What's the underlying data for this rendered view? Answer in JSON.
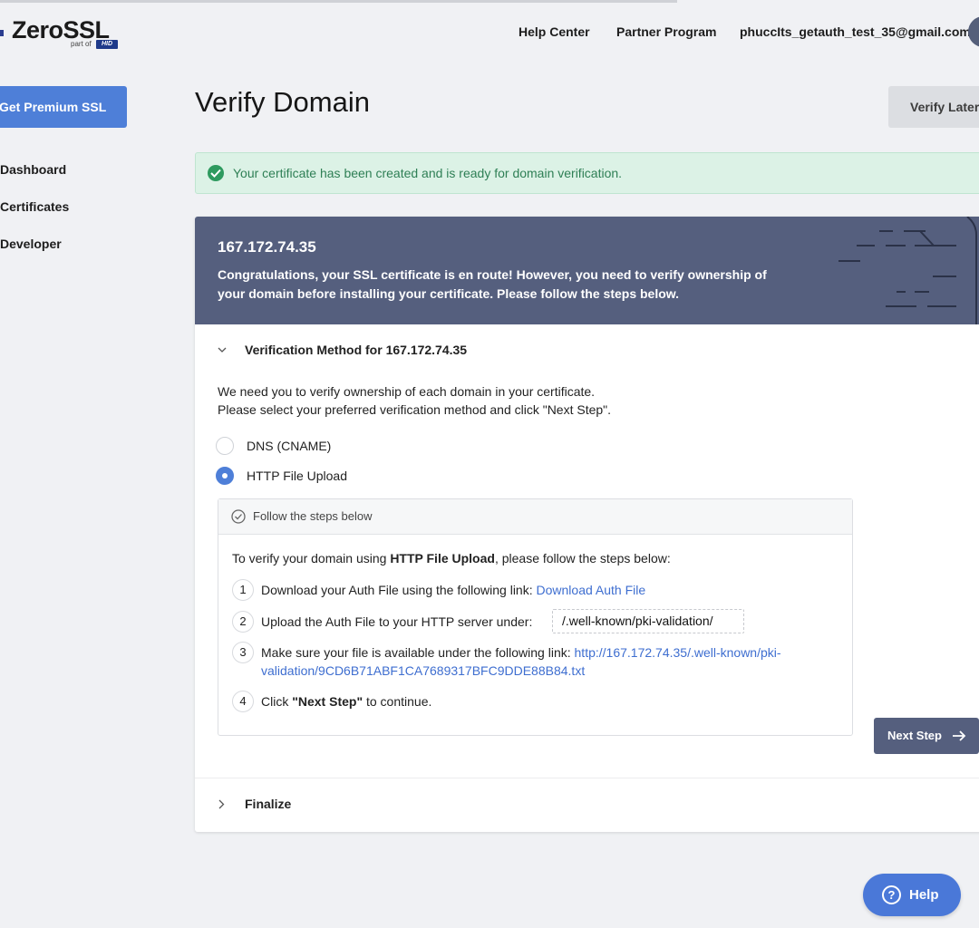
{
  "brand": {
    "name": "ZeroSSL",
    "sub": "part of",
    "parent": "HID"
  },
  "nav": {
    "help_center": "Help Center",
    "partner_program": "Partner Program",
    "user_email": "phuccIts_getauth_test_35@gmail.com"
  },
  "sidebar": {
    "premium_label": "Get Premium SSL",
    "items": [
      {
        "label": "Dashboard"
      },
      {
        "label": "Certificates"
      },
      {
        "label": "Developer"
      }
    ]
  },
  "page": {
    "title": "Verify Domain",
    "verify_later": "Verify Later"
  },
  "alert": {
    "text": "Your certificate has been created and is ready for domain verification.",
    "color": "#2e7f55"
  },
  "card": {
    "domain": "167.172.74.35",
    "description": "Congratulations, your SSL certificate is en route! However, you need to verify ownership of your domain before installing your certificate. Please follow the steps below.",
    "section_title": "Verification Method for 167.172.74.35",
    "intro_line1": "We need you to verify ownership of each domain in your certificate.",
    "intro_line2": "Please select your preferred verification method and click \"Next Step\".",
    "methods": [
      {
        "label": "DNS (CNAME)",
        "selected": false
      },
      {
        "label": "HTTP File Upload",
        "selected": true
      }
    ],
    "steps_header": "Follow the steps below",
    "steps_intro_before": "To verify your domain using ",
    "steps_intro_bold": "HTTP File Upload",
    "steps_intro_after": ", please follow the steps below:",
    "steps": [
      {
        "num": "1",
        "text": "Download your Auth File using the following link: ",
        "link": "Download Auth File"
      },
      {
        "num": "2",
        "text": "Upload the Auth File to your HTTP server under:",
        "path": "/.well-known/pki-validation/"
      },
      {
        "num": "3",
        "text": "Make sure your file is available under the following link: ",
        "link_line1": "http://167.172.74.35/.well-known/pki-",
        "link_line2": "validation/9CD6B71ABF1CA7689317BFC9DDE88B84.txt"
      },
      {
        "num": "4",
        "text_before": "Click ",
        "text_bold": "\"Next Step\"",
        "text_after": " to continue."
      }
    ],
    "next_step": "Next Step",
    "finalize": "Finalize"
  },
  "help_button": "Help",
  "colors": {
    "primary": "#4e7fd8",
    "header_slate": "#555f7e",
    "success": "#2e9a5f",
    "link": "#3e6ed0"
  }
}
